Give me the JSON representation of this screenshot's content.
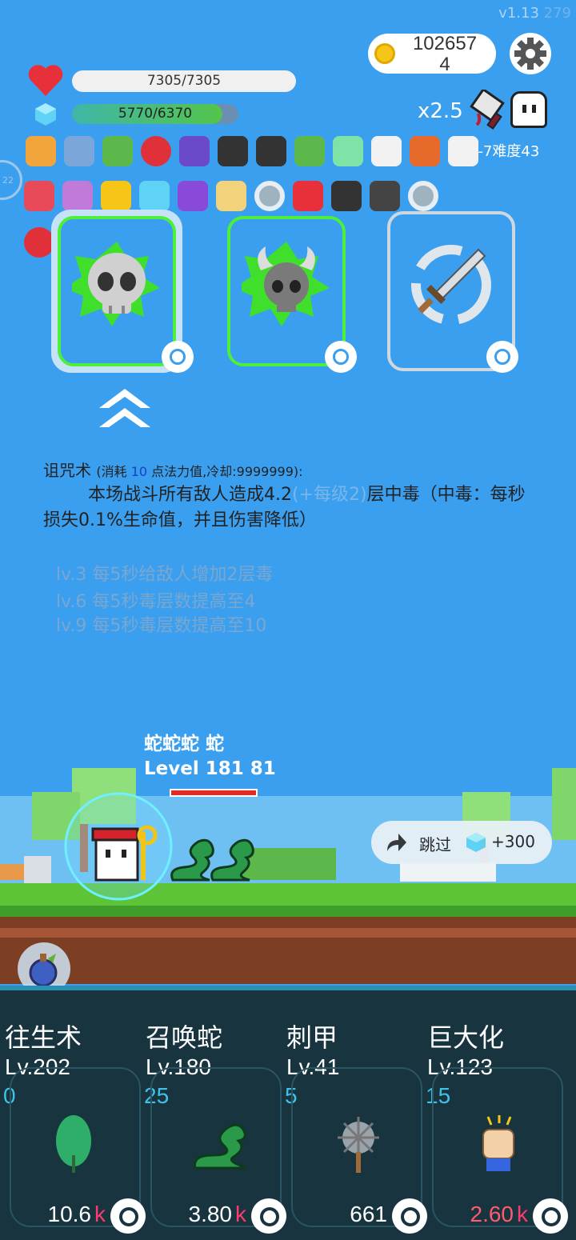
{
  "version": "v1.13",
  "build": "279",
  "coins": {
    "line1": "102657",
    "line2": "4"
  },
  "hp": {
    "text": "7305/7305",
    "current": 7305,
    "max": 7305
  },
  "mp": {
    "text": "5770/6370",
    "current": 5770,
    "max": 6370,
    "fill_fraction": 0.906
  },
  "speed": "x2.5",
  "difficulty": "6-7难度43",
  "side_tab_label": "22",
  "buffs": [
    "book-icon",
    "shield-icon",
    "tree-icon",
    "mushroom-icon",
    "wizard-hat-icon",
    "cauldron-icon",
    "bat-icon",
    "potted-plant-icon",
    "slime-icon",
    "wing-icon",
    "flame-icon",
    "wing-icon",
    "watermelon-icon",
    "unicorn-icon",
    "sun-icon",
    "diamond-icon",
    "crystal-ball-icon",
    "scroll-icon",
    "disc-icon",
    "sneaker-icon",
    "cauldron-icon",
    "skull-tombstone-icon",
    "disc-icon",
    "apple-icon"
  ],
  "skill_cards": [
    {
      "name": "skull",
      "selected": true
    },
    {
      "name": "viking-skull",
      "selected": false
    },
    {
      "name": "sword",
      "selected": false
    }
  ],
  "description": {
    "title": "诅咒术",
    "cost_prefix": "(消耗",
    "cost_value": "10",
    "cost_suffix": "点法力值,冷却:9999999):",
    "body_a": "本场战斗所有敌人造成4.2",
    "body_grey": "(+每级2)",
    "body_b": "层中毒（中毒：每秒损失0.1%生命值，并且伤害降低）",
    "levels": [
      "lv.3 每5秒给敌人增加2层毒",
      "lv.6 每5秒毒层数提高至4",
      "lv.9 每5秒毒层数提高至10"
    ]
  },
  "battle": {
    "enemy_names": "蛇蛇蛇 蛇",
    "enemy_levels": "Level 181 81"
  },
  "skip": {
    "label": "跳过",
    "reward": "+300"
  },
  "bottom_skills": [
    {
      "name": "往生术",
      "level": "Lv.202",
      "count": "0",
      "cost": "10.6",
      "cost_unit": "k",
      "icon": "leaf-icon",
      "cost_red": false
    },
    {
      "name": "召唤蛇",
      "level": "Lv.180",
      "count": "25",
      "cost": "3.80",
      "cost_unit": "k",
      "icon": "snake-icon",
      "cost_red": false
    },
    {
      "name": "刺甲",
      "level": "Lv.41",
      "count": "5",
      "cost": "661",
      "cost_unit": "",
      "icon": "spiked-mace-icon",
      "cost_red": false
    },
    {
      "name": "巨大化",
      "level": "Lv.123",
      "count": "15",
      "cost": "2.60",
      "cost_unit": "k",
      "icon": "fist-icon",
      "cost_red": true
    }
  ]
}
